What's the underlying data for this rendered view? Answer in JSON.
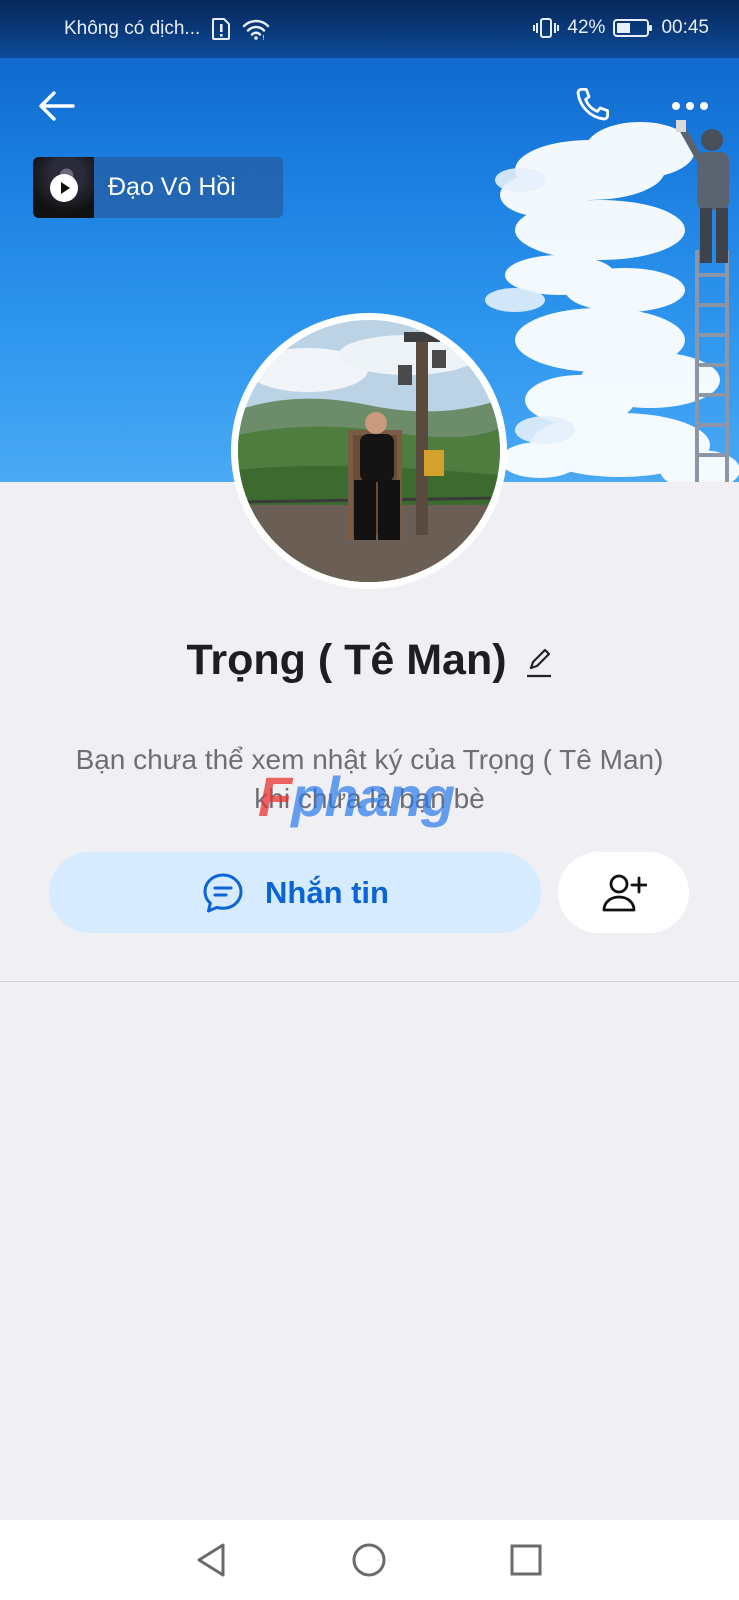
{
  "status_bar": {
    "carrier": "Không có dịch...",
    "battery_percent": "42%",
    "time": "00:45"
  },
  "header": {
    "music": {
      "title": "Đạo Vô Hồi"
    }
  },
  "profile": {
    "name": "Trọng ( Tê Man)",
    "diary_notice": "Bạn chưa thể xem nhật ký của Trọng ( Tê Man) khi chưa là bạn bè"
  },
  "actions": {
    "message_label": "Nhắn tin"
  },
  "watermark": {
    "first": "F",
    "rest": "phang"
  },
  "colors": {
    "accent": "#0b64d6",
    "message_button_bg": "#d7ebff",
    "page_bg": "#f0f0f4"
  },
  "icons": {
    "back": "arrow-left-icon",
    "call": "phone-icon",
    "more": "more-horizontal-icon",
    "edit": "pencil-icon",
    "message": "chat-bubble-icon",
    "add_friend": "user-plus-icon"
  }
}
